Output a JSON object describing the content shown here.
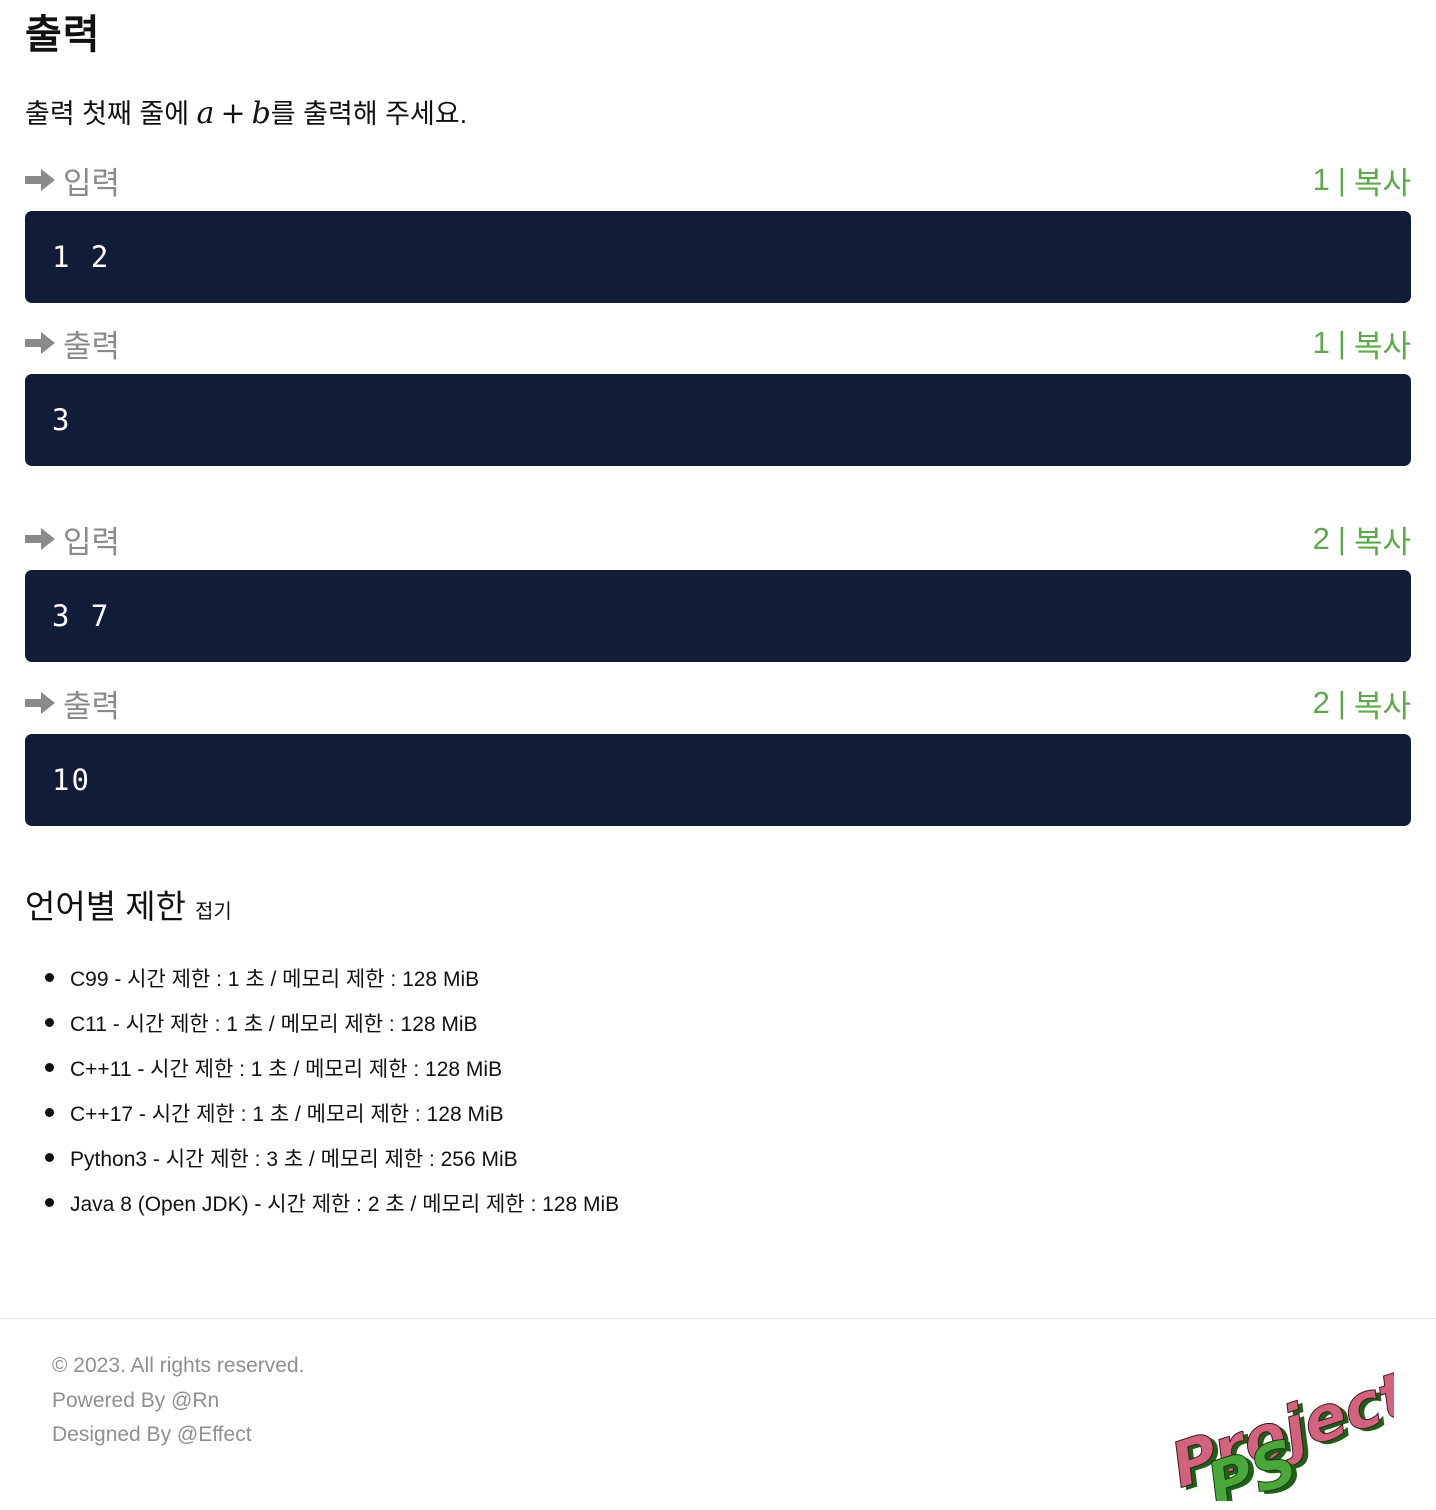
{
  "section": {
    "title": "출력"
  },
  "description": {
    "prefix": "출력 첫째 줄에 ",
    "var_a": "a",
    "operator": "+",
    "var_b": "b",
    "suffix": "를 출력해 주세요."
  },
  "samples": [
    {
      "input_label": "입력",
      "input_copy_index": "1",
      "input_copy_sep": "|",
      "input_copy_label": "복사",
      "input_value": "1 2",
      "output_label": "출력",
      "output_copy_index": "1",
      "output_copy_sep": "|",
      "output_copy_label": "복사",
      "output_value": "3"
    },
    {
      "input_label": "입력",
      "input_copy_index": "2",
      "input_copy_sep": "|",
      "input_copy_label": "복사",
      "input_value": "3 7",
      "output_label": "출력",
      "output_copy_index": "2",
      "output_copy_sep": "|",
      "output_copy_label": "복사",
      "output_value": "10"
    }
  ],
  "limits": {
    "title": "언어별 제한",
    "toggle_label": "접기",
    "items": [
      "C99 - 시간 제한 : 1 초 / 메모리 제한 : 128 MiB",
      "C11 - 시간 제한 : 1 초 / 메모리 제한 : 128 MiB",
      "C++11 - 시간 제한 : 1 초 / 메모리 제한 : 128 MiB",
      "C++17 - 시간 제한 : 1 초 / 메모리 제한 : 128 MiB",
      "Python3 - 시간 제한 : 3 초 / 메모리 제한 : 256 MiB",
      "Java 8 (Open JDK) - 시간 제한 : 2 초 / 메모리 제한 : 128 MiB"
    ]
  },
  "footer": {
    "copyright": "© 2023. All rights reserved.",
    "powered": "Powered By @Rn",
    "designed": "Designed By @Effect",
    "logo_word": "Project",
    "logo_badge": "PS"
  },
  "colors": {
    "code_bg": "#111d38",
    "copy_green": "#5fa84d",
    "label_gray": "#8a8a8a",
    "logo_pink": "#d3637d",
    "logo_green": "#4aa83a"
  }
}
